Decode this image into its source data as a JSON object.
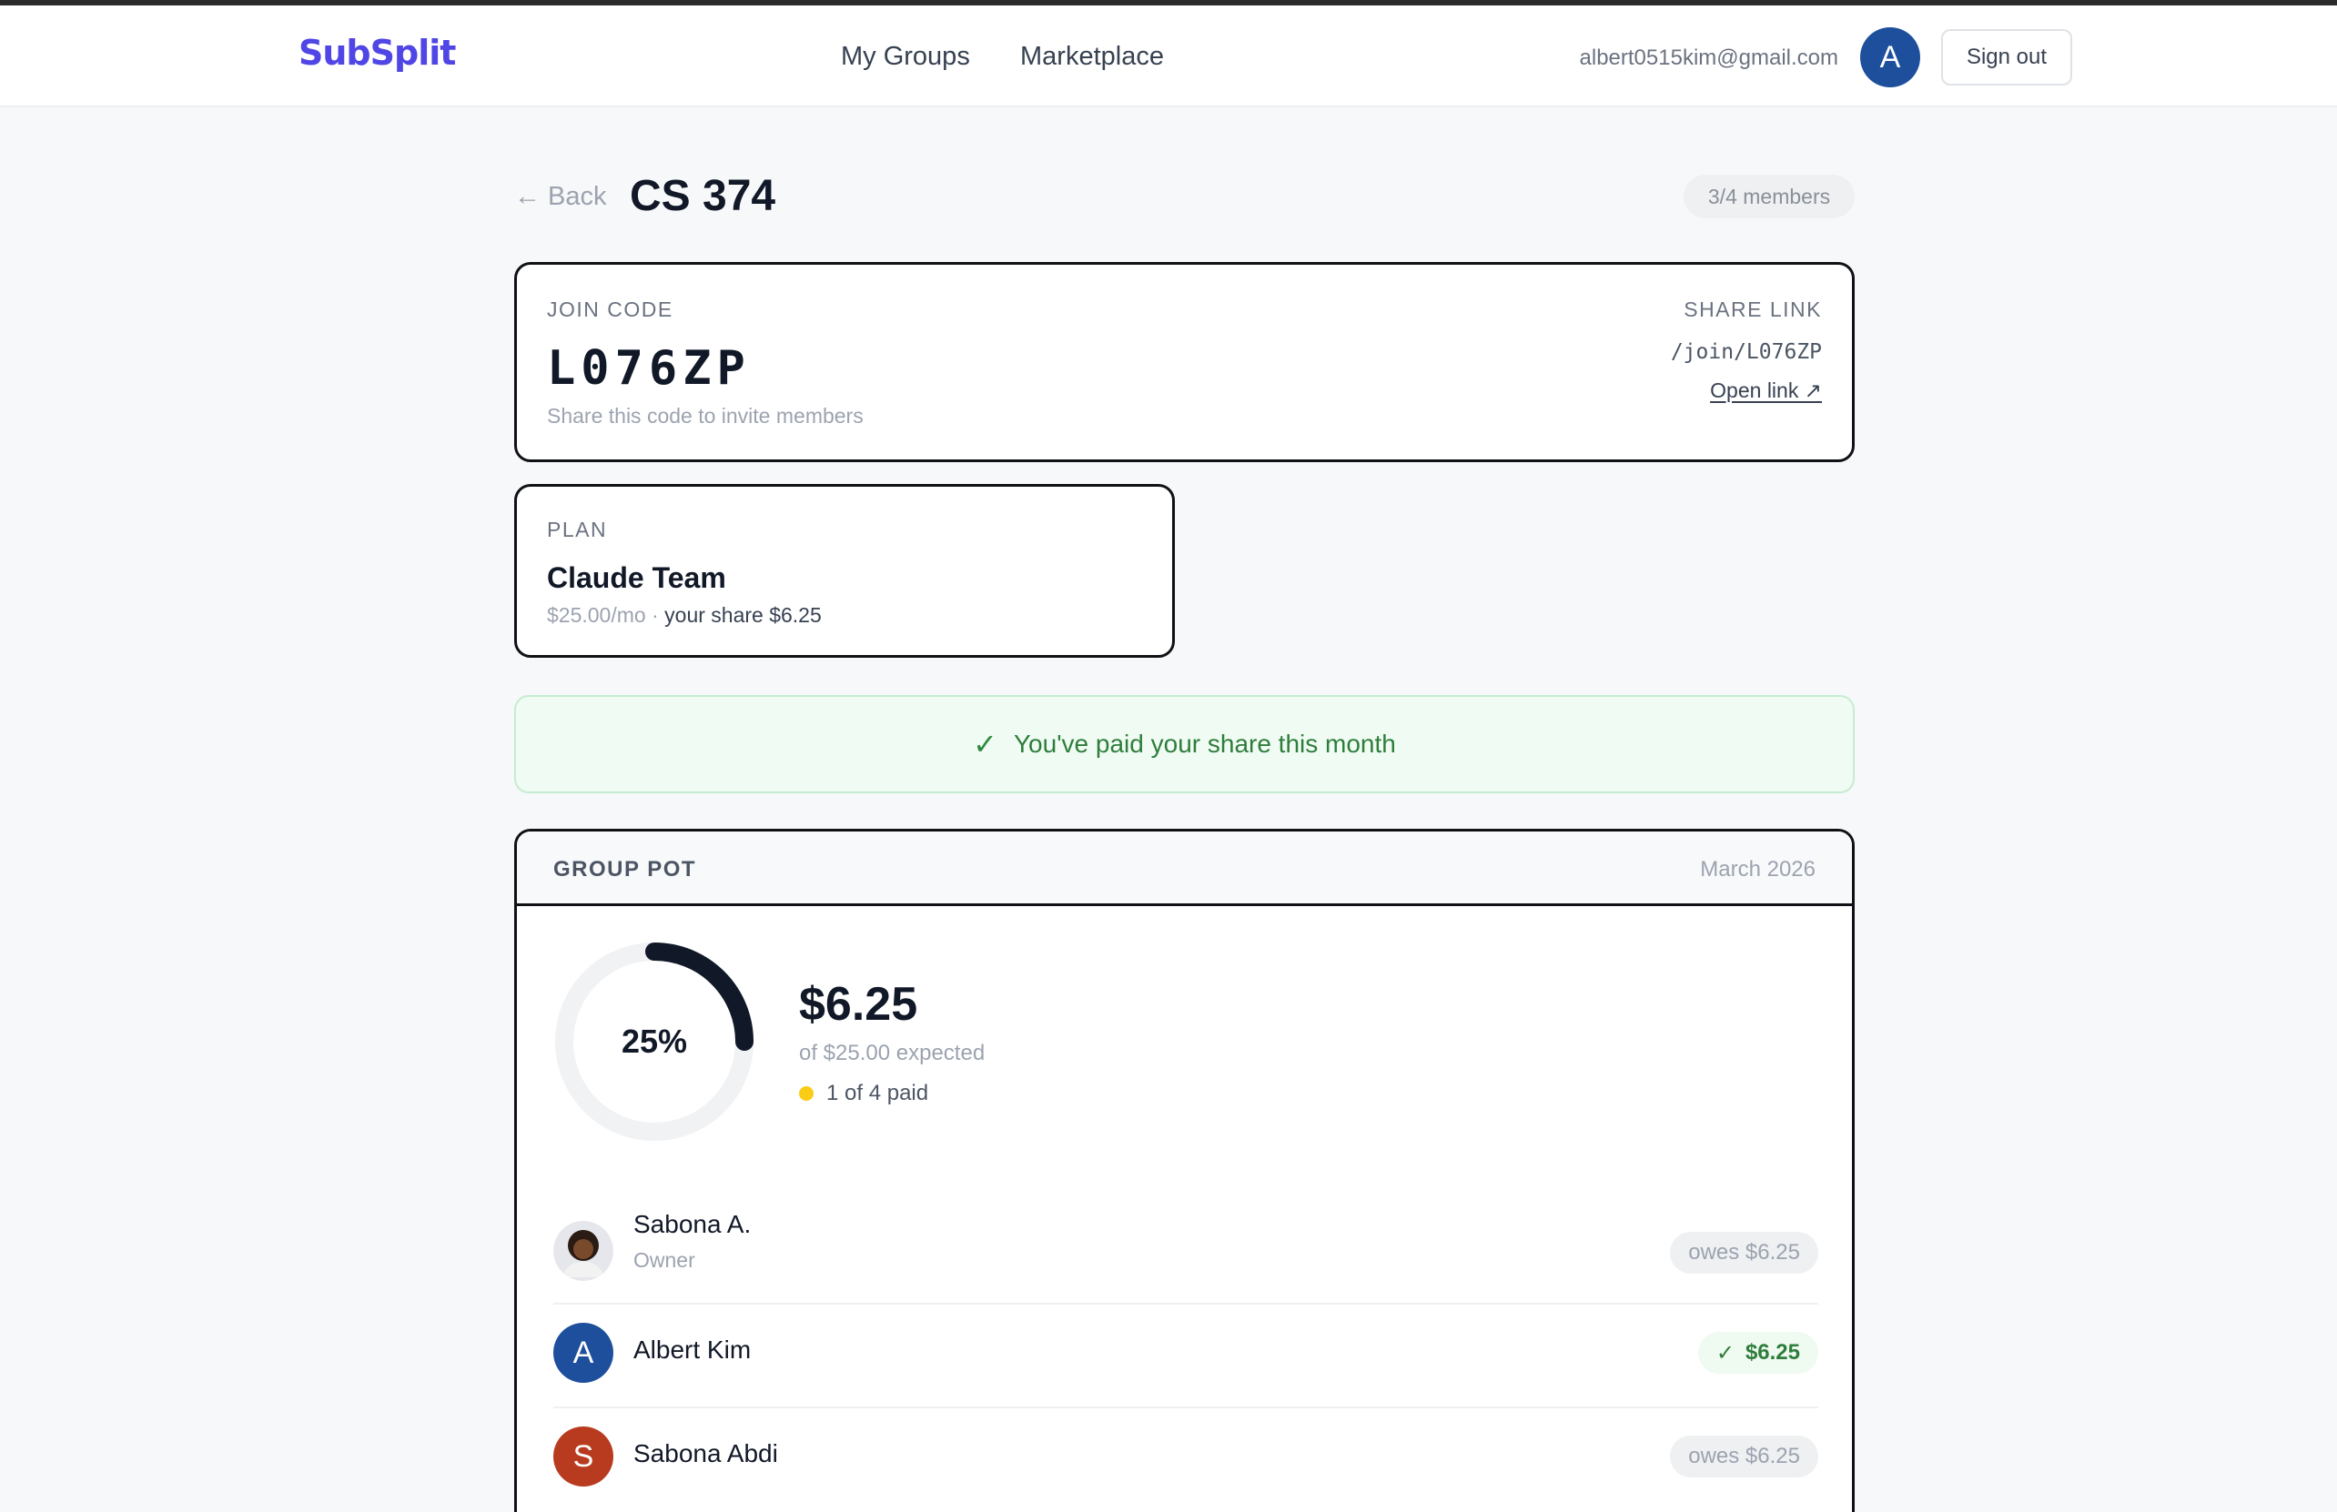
{
  "header": {
    "logo": "SubSplit",
    "nav": [
      "My Groups",
      "Marketplace"
    ],
    "user_email": "albert0515kim@gmail.com",
    "user_initial": "A",
    "sign_out": "Sign out"
  },
  "page": {
    "back": "← Back",
    "title": "CS 374",
    "members_badge": "3/4 members"
  },
  "join": {
    "label": "JOIN CODE",
    "code": "L076ZP",
    "hint": "Share this code to invite members",
    "share_label": "SHARE LINK",
    "share_path": "/join/L076ZP",
    "open_link": "Open link ↗"
  },
  "plan": {
    "label": "PLAN",
    "name": "Claude Team",
    "price": "$25.00/mo",
    "separator": " · ",
    "share": "your share $6.25"
  },
  "banner": {
    "icon": "check-icon",
    "text": "You've paid your share this month"
  },
  "pot": {
    "label": "GROUP POT",
    "month": "March 2026",
    "percent_label": "25%",
    "progress_fraction": 0.25,
    "amount": "$6.25",
    "expected": "of $25.00 expected",
    "paid_count": "1 of 4 paid",
    "colors": {
      "ring": "#111827",
      "ring_track": "#f1f2f4",
      "pending_dot": "#facc15",
      "paid_green": "#2f7d3c"
    },
    "members": [
      {
        "name": "Sabona A.",
        "role": "Owner",
        "initial": "",
        "avatar": "photo",
        "status": "owes",
        "badge": "owes $6.25"
      },
      {
        "name": "Albert Kim",
        "role": "",
        "initial": "A",
        "avatar_color": "#1e4f9c",
        "status": "paid",
        "badge_check": "✓",
        "badge": "$6.25"
      },
      {
        "name": "Sabona Abdi",
        "role": "",
        "initial": "S",
        "avatar_color": "#b83b1f",
        "status": "owes",
        "badge": "owes $6.25"
      }
    ]
  }
}
